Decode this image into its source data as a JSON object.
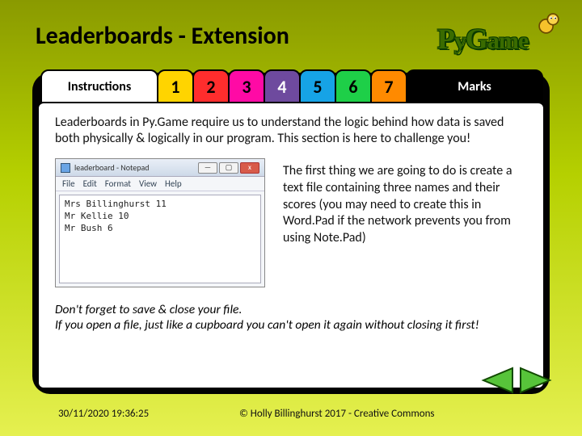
{
  "title": "Leaderboards - Extension",
  "logo_text_html": "PyGame",
  "tabs": {
    "instructions": "Instructions",
    "n1": "1",
    "n2": "2",
    "n3": "3",
    "n4": "4",
    "n5": "5",
    "n6": "6",
    "n7": "7",
    "marks": "Marks"
  },
  "intro": "Leaderboards in Py.Game require us to understand the logic behind how data is saved both physically & logically in our program. This section is here to challenge you!",
  "notepad": {
    "title": "leaderboard - Notepad",
    "menus": {
      "m1": "File",
      "m2": "Edit",
      "m3": "Format",
      "m4": "View",
      "m5": "Help"
    },
    "lines": {
      "l1": "Mrs Billinghurst 11",
      "l2": "Mr Kellie 10",
      "l3": "Mr Bush 6"
    },
    "min": "—",
    "max": "▢",
    "close": "x"
  },
  "side_para": "The first thing we are going to do is create a text file containing three names and their scores (you may need to create this in Word.Pad if the network prevents you from using Note.Pad)",
  "note_l1": "Don't forget to save & close your file.",
  "note_l2": "If you open a file, just like a cupboard you can't open it again without closing it first!",
  "footer": {
    "timestamp": "30/11/2020 19:36:25",
    "copyright": "© Holly Billinghurst 2017 - Creative Commons"
  }
}
